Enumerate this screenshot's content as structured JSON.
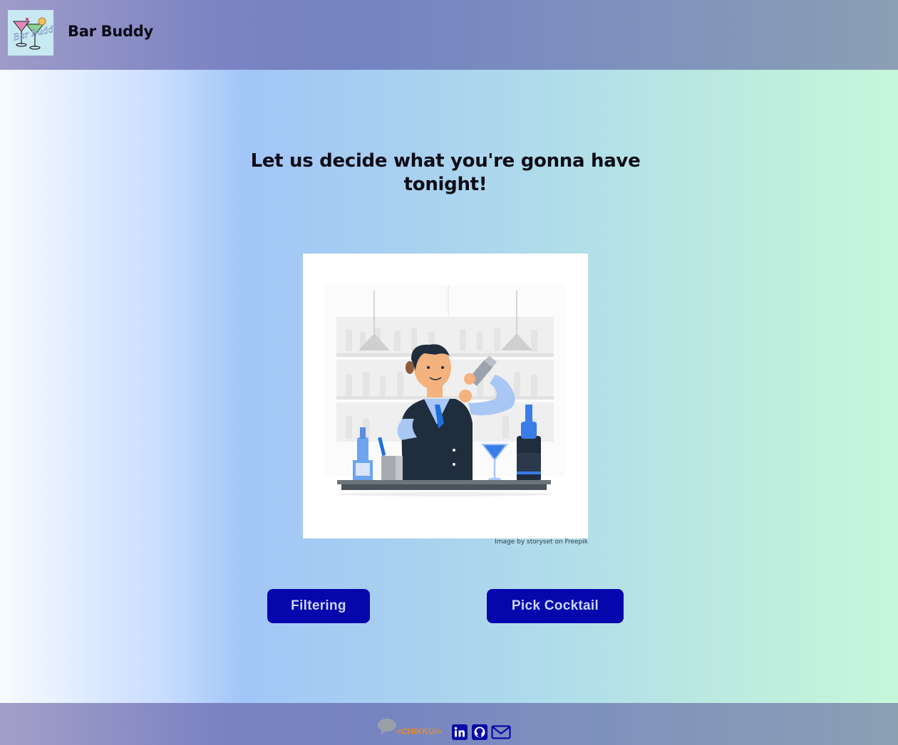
{
  "header": {
    "logo_alt": "Bar Buddy logo",
    "logo_text": "Bar Buddy",
    "title": "Bar Buddy"
  },
  "hero": {
    "title": "Let us decide what you're gonna have tonight!",
    "image": "bartender-illustration",
    "credit": "Image by storyset on Freepik"
  },
  "actions": {
    "filtering_label": "Filtering",
    "pick_label": "Pick Cocktail"
  },
  "footer": {
    "brand_text": "<CHIKKU/>",
    "links": [
      {
        "name": "linkedin",
        "icon": "linkedin-icon"
      },
      {
        "name": "github",
        "icon": "github-icon"
      },
      {
        "name": "email",
        "icon": "mail-icon"
      }
    ]
  },
  "colors": {
    "button_bg": "#0606ad",
    "button_text": "#ccd7f5",
    "footer_icon": "#0a0aa8",
    "brand_accent": "#e08a35"
  }
}
